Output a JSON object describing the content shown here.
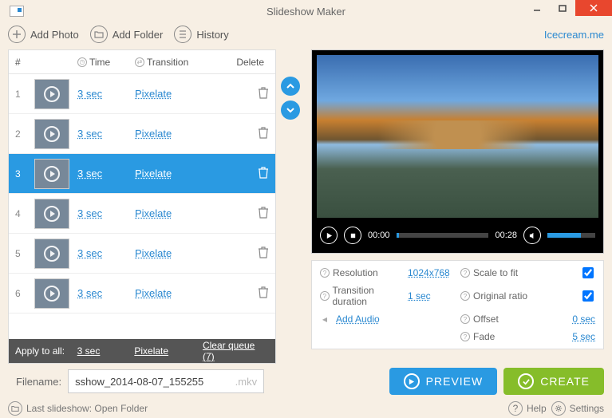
{
  "title": "Slideshow Maker",
  "toolbar": {
    "add_photo": "Add Photo",
    "add_folder": "Add Folder",
    "history": "History",
    "brand": "Icecream.me"
  },
  "table": {
    "headers": {
      "num": "#",
      "time": "Time",
      "transition": "Transition",
      "delete": "Delete"
    },
    "rows": [
      {
        "n": "1",
        "time": "3 sec",
        "transition": "Pixelate",
        "selected": false,
        "thumb": "tb1"
      },
      {
        "n": "2",
        "time": "3 sec",
        "transition": "Pixelate",
        "selected": false,
        "thumb": "tb2"
      },
      {
        "n": "3",
        "time": "3 sec",
        "transition": "Pixelate",
        "selected": true,
        "thumb": "tb3"
      },
      {
        "n": "4",
        "time": "3 sec",
        "transition": "Pixelate",
        "selected": false,
        "thumb": "tb4"
      },
      {
        "n": "5",
        "time": "3 sec",
        "transition": "Pixelate",
        "selected": false,
        "thumb": "tb5"
      },
      {
        "n": "6",
        "time": "3 sec",
        "transition": "Pixelate",
        "selected": false,
        "thumb": "tb6"
      }
    ],
    "apply": {
      "label": "Apply to all:",
      "time": "3 sec",
      "transition": "Pixelate",
      "clear": "Clear queue (7)"
    }
  },
  "player": {
    "pos": "00:00",
    "dur": "00:28"
  },
  "settings": {
    "resolution_label": "Resolution",
    "resolution": "1024x768",
    "trdur_label": "Transition duration",
    "trdur": "1 sec",
    "scale_label": "Scale to fit",
    "ratio_label": "Original ratio",
    "offset_label": "Offset",
    "offset": "0 sec",
    "fade_label": "Fade",
    "fade": "5 sec",
    "audio": "Add Audio"
  },
  "filename": {
    "label": "Filename:",
    "value": "sshow_2014-08-07_155255",
    "ext": ".mkv"
  },
  "buttons": {
    "preview": "PREVIEW",
    "create": "CREATE"
  },
  "status": {
    "last": "Last slideshow: Open Folder",
    "help": "Help",
    "settings": "Settings"
  }
}
